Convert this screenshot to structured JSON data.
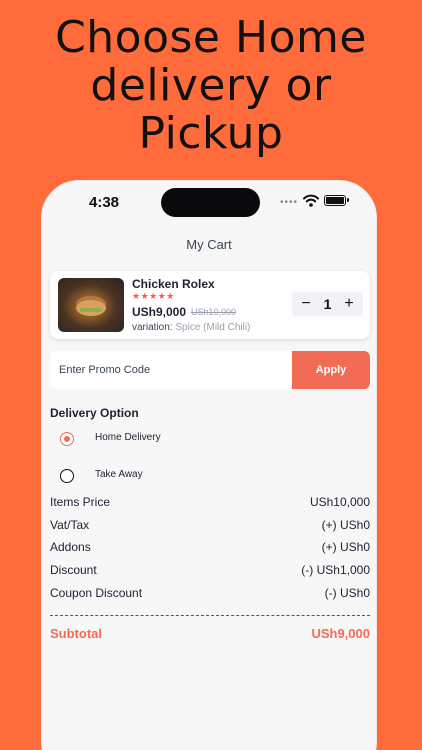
{
  "headline": [
    "Choose Home",
    "delivery or",
    "Pickup"
  ],
  "status_bar": {
    "time": "4:38"
  },
  "cart": {
    "title": "My Cart",
    "item": {
      "name": "Chicken Rolex",
      "stars": "★★★★★",
      "rating": 5,
      "price": "USh9,000",
      "old_price": "USh10,000",
      "variation_label": "variation:",
      "variation_value": "Spice (Mild Chili)",
      "quantity": "1",
      "minus_label": "−",
      "plus_label": "+"
    },
    "promo": {
      "placeholder": "Enter Promo Code",
      "value": "",
      "apply_label": "Apply"
    },
    "delivery": {
      "title": "Delivery Option",
      "options": [
        {
          "label": "Home Delivery",
          "selected": true
        },
        {
          "label": "Take Away",
          "selected": false
        }
      ]
    },
    "summary": [
      {
        "label": "Items Price",
        "value": "USh10,000"
      },
      {
        "label": "Vat/Tax",
        "value": "(+) USh0"
      },
      {
        "label": "Addons",
        "value": "(+) USh0"
      },
      {
        "label": "Discount",
        "value": "(-) USh1,000"
      },
      {
        "label": "Coupon Discount",
        "value": "(-) USh0"
      }
    ],
    "subtotal": {
      "label": "Subtotal",
      "value": "USh9,000"
    }
  },
  "colors": {
    "background": "#ff6b3a",
    "accent": "#f26b55",
    "text": "#1d2230"
  }
}
